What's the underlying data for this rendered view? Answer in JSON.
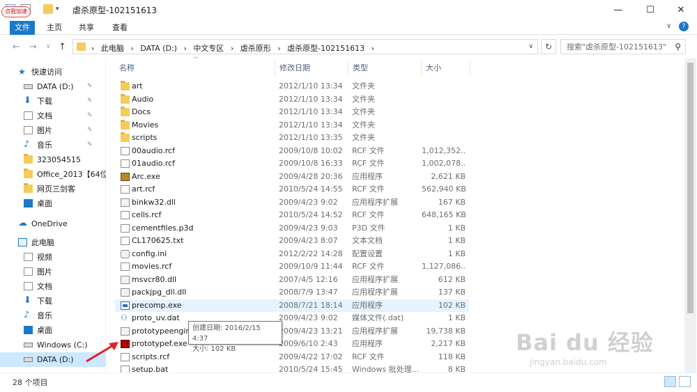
{
  "window": {
    "title": "虐杀原型-102151613",
    "controls": {
      "minimize": "—",
      "maximize": "☐",
      "close": "✕"
    }
  },
  "ribbon": {
    "tabs": [
      "文件",
      "主页",
      "共享",
      "查看"
    ],
    "chevron": "∨",
    "help": "?"
  },
  "address": {
    "crumbs": [
      "此电脑",
      "DATA (D:)",
      "中文专区",
      "虐杀原形",
      "虐杀原型-102151613"
    ],
    "separator": "›",
    "refresh_icon": "↻"
  },
  "search": {
    "placeholder": "搜索\"虐杀原型-102151613\"",
    "icon": "search-icon"
  },
  "nav": [
    {
      "label": "快速访问",
      "icon": "star-icon",
      "level": 0
    },
    {
      "label": "DATA (D:)",
      "icon": "drive-icon",
      "pinned": true,
      "level": 1
    },
    {
      "label": "下载",
      "icon": "download-icon",
      "pinned": true,
      "level": 1
    },
    {
      "label": "文档",
      "icon": "document-icon",
      "pinned": true,
      "level": 1
    },
    {
      "label": "图片",
      "icon": "pictures-icon",
      "pinned": true,
      "level": 1
    },
    {
      "label": "音乐",
      "icon": "music-icon",
      "pinned": true,
      "level": 1
    },
    {
      "label": "323054515",
      "icon": "folder-icon",
      "level": 1
    },
    {
      "label": "Office_2013【64位",
      "icon": "folder-icon",
      "level": 1
    },
    {
      "label": "网页三剑客",
      "icon": "folder-icon",
      "level": 1
    },
    {
      "label": "桌面",
      "icon": "desktop-icon",
      "level": 1
    },
    {
      "label": "OneDrive",
      "icon": "cloud-icon",
      "level": 0
    },
    {
      "label": "此电脑",
      "icon": "pc-icon",
      "level": 0
    },
    {
      "label": "视频",
      "icon": "video-icon",
      "level": 1
    },
    {
      "label": "图片",
      "icon": "pictures-icon",
      "level": 1
    },
    {
      "label": "文档",
      "icon": "document-icon",
      "level": 1
    },
    {
      "label": "下载",
      "icon": "download-icon",
      "level": 1
    },
    {
      "label": "音乐",
      "icon": "music-icon",
      "level": 1
    },
    {
      "label": "桌面",
      "icon": "desktop-icon",
      "level": 1
    },
    {
      "label": "Windows (C:)",
      "icon": "windows-drive-icon",
      "level": 1
    },
    {
      "label": "DATA (D:)",
      "icon": "drive-icon",
      "level": 1,
      "selected": true
    }
  ],
  "columns": {
    "name": "名称",
    "date": "修改日期",
    "type": "类型",
    "size": "大小"
  },
  "files": [
    {
      "name": "art",
      "date": "2012/1/10 13:34",
      "type": "文件夹",
      "size": "",
      "icon": "folder-icon"
    },
    {
      "name": "Audio",
      "date": "2012/1/10 13:34",
      "type": "文件夹",
      "size": "",
      "icon": "folder-icon"
    },
    {
      "name": "Docs",
      "date": "2012/1/10 13:34",
      "type": "文件夹",
      "size": "",
      "icon": "folder-icon"
    },
    {
      "name": "Movies",
      "date": "2012/1/10 13:34",
      "type": "文件夹",
      "size": "",
      "icon": "folder-icon"
    },
    {
      "name": "scripts",
      "date": "2012/1/10 13:35",
      "type": "文件夹",
      "size": "",
      "icon": "folder-icon"
    },
    {
      "name": "00audio.rcf",
      "date": "2009/10/8 10:02",
      "type": "RCF 文件",
      "size": "1,012,352...",
      "icon": "file-icon"
    },
    {
      "name": "01audio.rcf",
      "date": "2009/10/8 16:33",
      "type": "RCF 文件",
      "size": "1,002,078...",
      "icon": "file-icon"
    },
    {
      "name": "Arc.exe",
      "date": "2009/4/28 20:36",
      "type": "应用程序",
      "size": "2,621 KB",
      "icon": "archive-exe-icon"
    },
    {
      "name": "art.rcf",
      "date": "2010/5/24 14:55",
      "type": "RCF 文件",
      "size": "562,940 KB",
      "icon": "file-icon"
    },
    {
      "name": "binkw32.dll",
      "date": "2009/4/23 9:02",
      "type": "应用程序扩展",
      "size": "167 KB",
      "icon": "dll-icon"
    },
    {
      "name": "cells.rcf",
      "date": "2010/5/24 14:52",
      "type": "RCF 文件",
      "size": "648,165 KB",
      "icon": "file-icon"
    },
    {
      "name": "cementfiles.p3d",
      "date": "2009/4/23 9:03",
      "type": "P3D 文件",
      "size": "1 KB",
      "icon": "file-icon"
    },
    {
      "name": "CL170625.txt",
      "date": "2009/4/23 8:07",
      "type": "文本文档",
      "size": "1 KB",
      "icon": "text-file-icon"
    },
    {
      "name": "config.ini",
      "date": "2012/2/22 14:28",
      "type": "配置设置",
      "size": "1 KB",
      "icon": "config-icon"
    },
    {
      "name": "movies.rcf",
      "date": "2009/10/9 11:44",
      "type": "RCF 文件",
      "size": "1,127,086...",
      "icon": "file-icon"
    },
    {
      "name": "msvcr80.dll",
      "date": "2007/4/5 12:16",
      "type": "应用程序扩展",
      "size": "612 KB",
      "icon": "dll-icon"
    },
    {
      "name": "packjpg_dll.dll",
      "date": "2008/7/9 13:47",
      "type": "应用程序扩展",
      "size": "137 KB",
      "icon": "dll-icon"
    },
    {
      "name": "precomp.exe",
      "date": "2008/7/21 18:14",
      "type": "应用程序",
      "size": "102 KB",
      "icon": "exe-icon",
      "hover": true
    },
    {
      "name": "proto_uv.dat",
      "date": "2009/4/23 9:02",
      "type": "媒体文件(.dat)",
      "size": "1 KB",
      "icon": "media-file-icon"
    },
    {
      "name": "prototypeengine.dll",
      "date": "2009/4/23 13:21",
      "type": "应用程序扩展",
      "size": "19,738 KB",
      "icon": "dll-icon"
    },
    {
      "name": "prototypef.exe",
      "date": "2009/6/10 2:43",
      "type": "应用程序",
      "size": "2,217 KB",
      "icon": "game-exe-icon"
    },
    {
      "name": "scripts.rcf",
      "date": "2009/4/22 17:02",
      "type": "RCF 文件",
      "size": "118 KB",
      "icon": "file-icon"
    },
    {
      "name": "setup.bat",
      "date": "2010/5/24 15:45",
      "type": "Windows 批处理...",
      "size": "8 KB",
      "icon": "batch-file-icon"
    }
  ],
  "tooltip": {
    "line1": "创建日期: 2016/2/15 4:37",
    "line2": "大小: 102 KB"
  },
  "status": {
    "count": "28 个项目"
  },
  "badge": {
    "label": "点我加速"
  },
  "watermark": {
    "main": "Bai du 经验",
    "sub": "jingyan.baidu.com"
  },
  "colors": {
    "accent": "#1979ca",
    "selected": "#cce8ff",
    "hover": "#e5f3ff",
    "annotation_arrow": "#e02020"
  }
}
